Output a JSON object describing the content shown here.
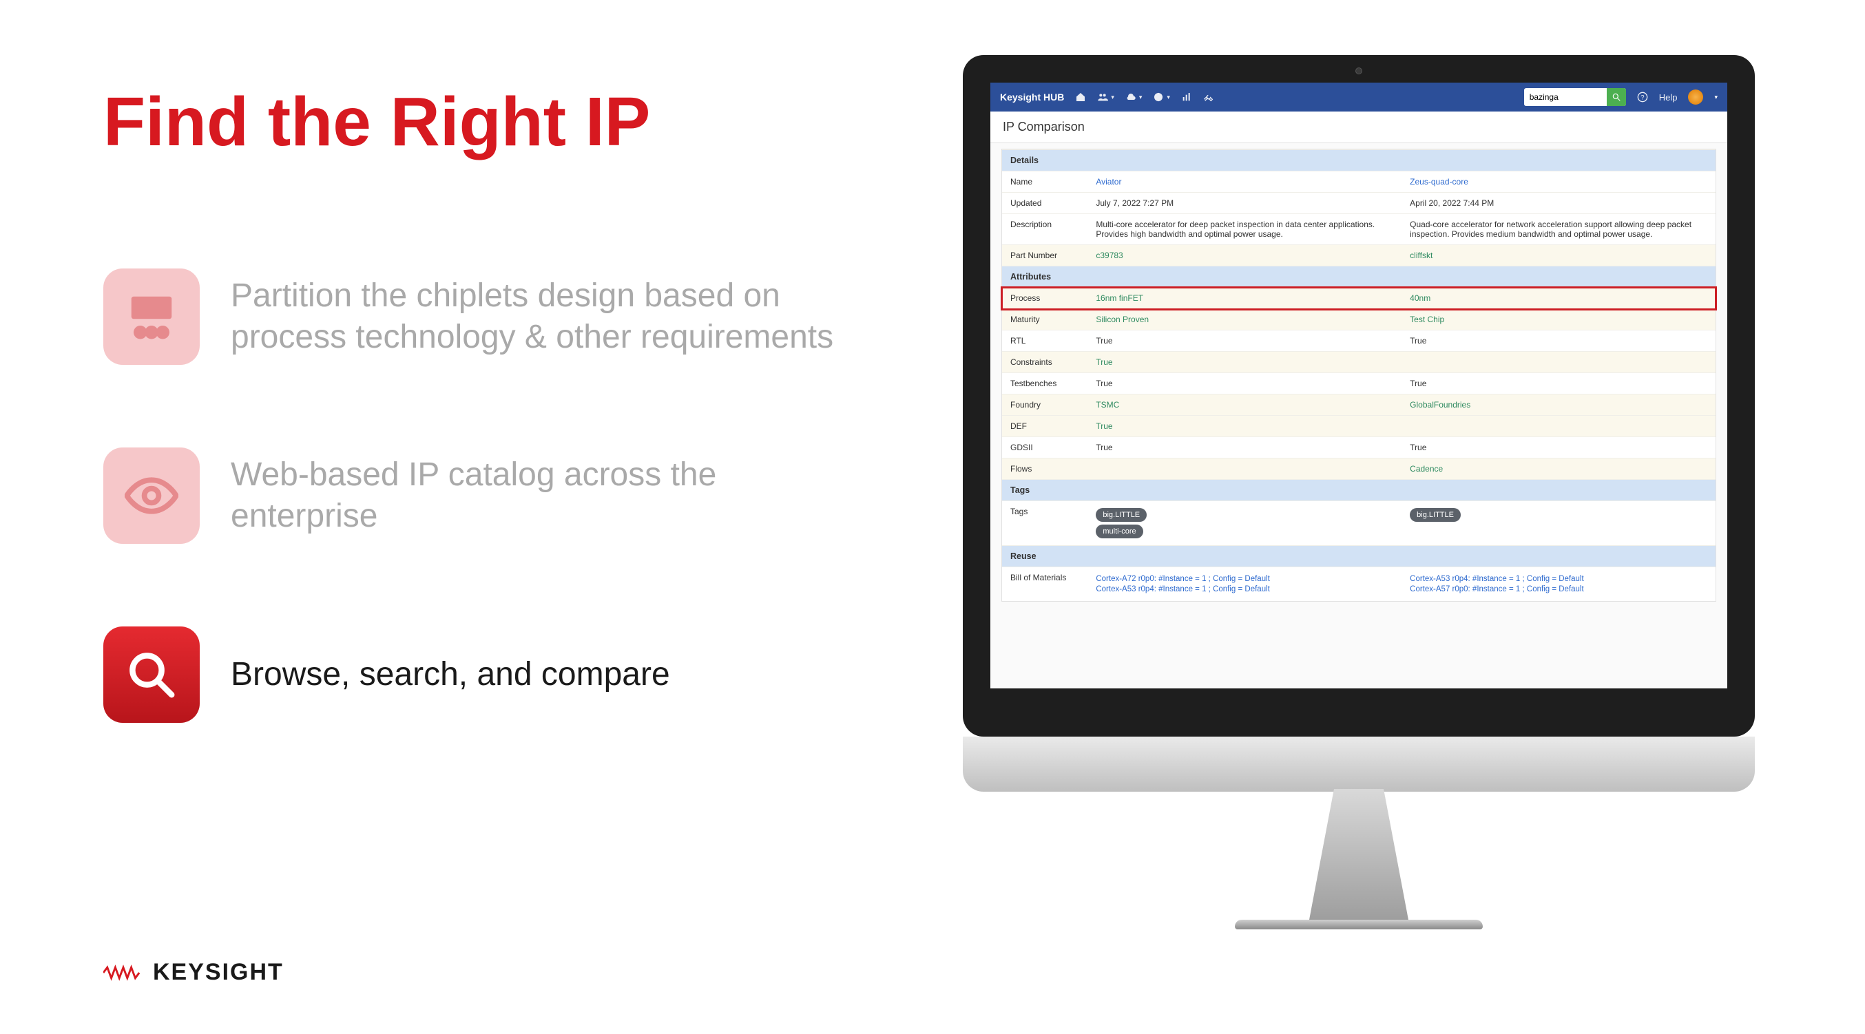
{
  "slide": {
    "title": "Find the Right IP",
    "bullets": [
      {
        "text": "Partition the chiplets design based on process technology & other requirements",
        "active": false,
        "icon": "group"
      },
      {
        "text": "Web-based IP catalog across the enterprise",
        "active": false,
        "icon": "eye"
      },
      {
        "text": "Browse, search, and compare",
        "active": true,
        "icon": "search"
      }
    ]
  },
  "brand": "KEYSIGHT",
  "app": {
    "brand": "Keysight HUB",
    "search_value": "bazinga",
    "help": "Help",
    "page_title": "IP Comparison",
    "sections": {
      "details": "Details",
      "attributes": "Attributes",
      "tags": "Tags",
      "reuse": "Reuse"
    },
    "rows": {
      "name_label": "Name",
      "name": [
        "Aviator",
        "Zeus-quad-core"
      ],
      "updated_label": "Updated",
      "updated": [
        "July 7, 2022 7:27 PM",
        "April 20, 2022 7:44 PM"
      ],
      "description_label": "Description",
      "description": [
        "Multi-core accelerator for deep packet inspection in data center applications. Provides high bandwidth and optimal power usage.",
        "Quad-core accelerator for network acceleration support allowing deep packet inspection. Provides medium bandwidth and optimal power usage."
      ],
      "part_label": "Part Number",
      "part": [
        "c39783",
        "cliffskt"
      ],
      "process_label": "Process",
      "process": [
        "16nm finFET",
        "40nm"
      ],
      "maturity_label": "Maturity",
      "maturity": [
        "Silicon Proven",
        "Test Chip"
      ],
      "rtl_label": "RTL",
      "rtl": [
        "True",
        "True"
      ],
      "constraints_label": "Constraints",
      "constraints": [
        "True",
        ""
      ],
      "testbenches_label": "Testbenches",
      "testbenches": [
        "True",
        "True"
      ],
      "foundry_label": "Foundry",
      "foundry": [
        "TSMC",
        "GlobalFoundries"
      ],
      "def_label": "DEF",
      "def": [
        "True",
        ""
      ],
      "gdsii_label": "GDSII",
      "gdsii": [
        "True",
        "True"
      ],
      "flows_label": "Flows",
      "flows": [
        "",
        "Cadence"
      ],
      "tags_label": "Tags",
      "tags_a": [
        "big.LITTLE",
        "multi-core"
      ],
      "tags_b": [
        "big.LITTLE"
      ],
      "bom_label": "Bill of Materials",
      "bom_a": [
        "Cortex-A72 r0p0: #Instance = 1 ; Config = Default",
        "Cortex-A53 r0p4: #Instance = 1 ; Config = Default"
      ],
      "bom_b": [
        "Cortex-A53 r0p4: #Instance = 1 ; Config = Default",
        "Cortex-A57 r0p0: #Instance = 1 ; Config = Default"
      ]
    }
  }
}
